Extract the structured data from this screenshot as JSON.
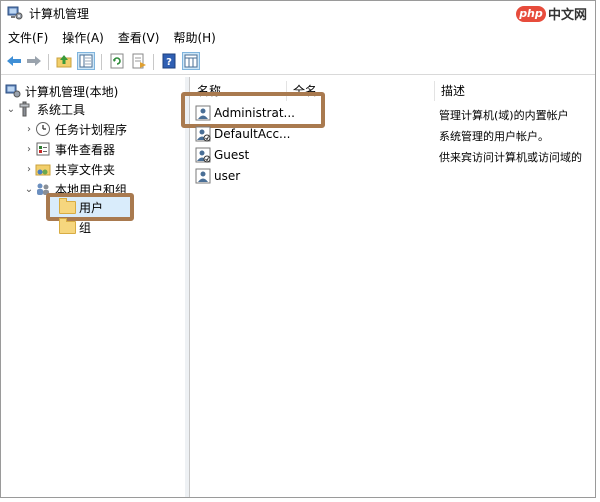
{
  "window": {
    "title": "计算机管理"
  },
  "watermark": {
    "logo": "php",
    "text": "中文网"
  },
  "menu": [
    "文件(F)",
    "操作(A)",
    "查看(V)",
    "帮助(H)"
  ],
  "toolbar": [
    "back-icon",
    "forward-icon",
    "up-folder-icon",
    "show-hide-tree-icon",
    "refresh-icon",
    "export-list-icon",
    "help-icon",
    "properties-icon"
  ],
  "tree": {
    "root": "计算机管理(本地)",
    "system_tools": "系统工具",
    "task_scheduler": "任务计划程序",
    "event_viewer": "事件查看器",
    "shared_folders": "共享文件夹",
    "local_users": "本地用户和组",
    "users": "用户",
    "groups": "组"
  },
  "columns": {
    "name": "名称",
    "fullname": "全名",
    "description": "描述"
  },
  "users": [
    {
      "name": "Administrat...",
      "description": "管理计算机(域)的内置帐户"
    },
    {
      "name": "DefaultAcc...",
      "description": "系统管理的用户帐户。"
    },
    {
      "name": "Guest",
      "description": "供来宾访问计算机或访问域的"
    },
    {
      "name": "user",
      "description": ""
    }
  ],
  "colors": {
    "highlight_border": "#a97a4f",
    "selection": "#d9ecfb"
  }
}
